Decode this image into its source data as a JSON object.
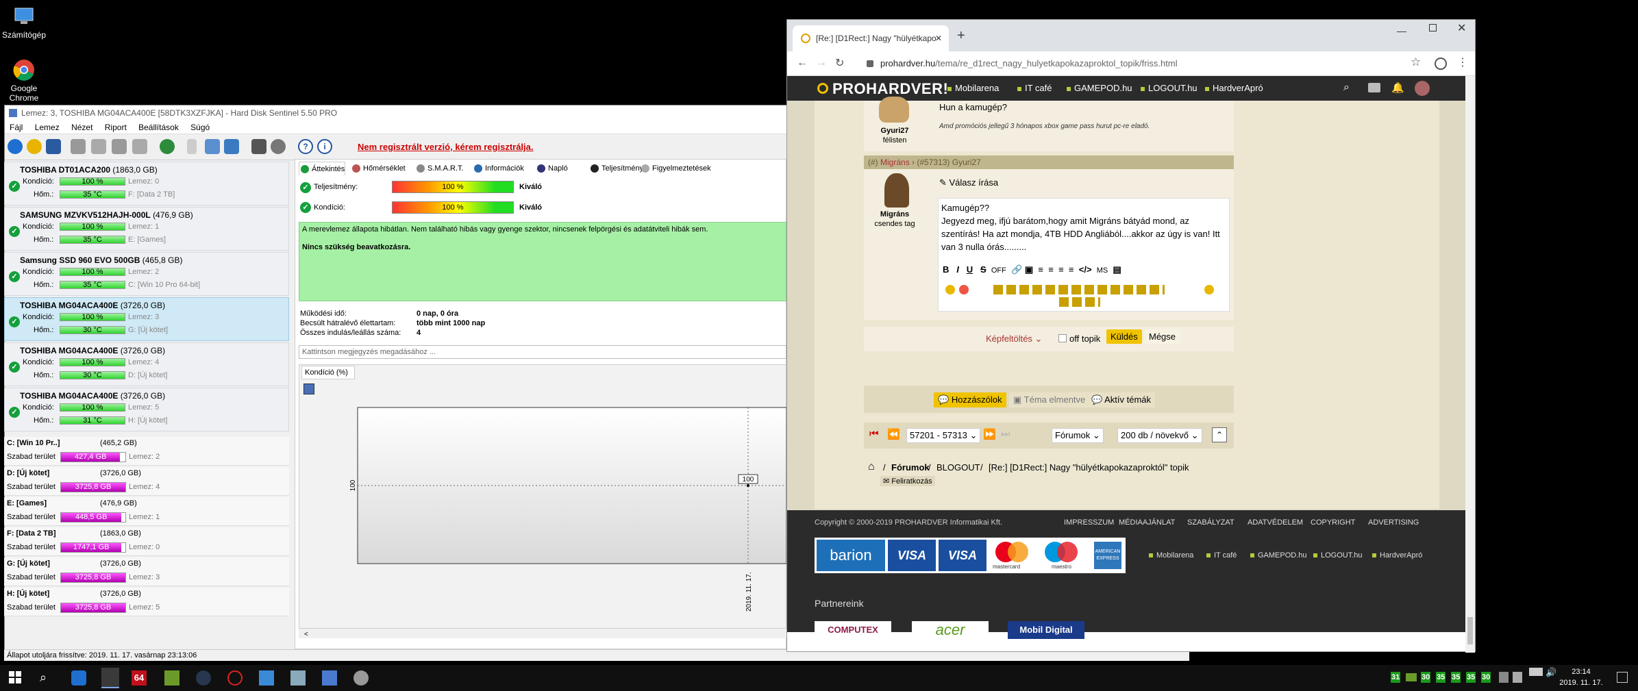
{
  "desktop": {
    "icons": [
      {
        "label": "Számítógép",
        "icon": "computer-icon"
      },
      {
        "label": "Google Chrome",
        "icon": "chrome-icon"
      }
    ]
  },
  "hds": {
    "title": "Lemez: 3, TOSHIBA MG04ACA400E [58DTK3XZFJKA] - Hard Disk Sentinel 5.50 PRO",
    "menu": [
      "Fájl",
      "Lemez",
      "Nézet",
      "Riport",
      "Beállítások",
      "Súgó"
    ],
    "register": "Nem regisztrált verzió, kérem regisztrálja.",
    "labels": {
      "cond": "Kondíció:",
      "temp": "Hőm.:",
      "free": "Szabad terület"
    },
    "disks": [
      {
        "name": "TOSHIBA DT01ACA200",
        "size": "(1863,0 GB)",
        "health": "100 %",
        "temp": "35 °C",
        "disk": "Lemez: 0",
        "vol": "F: [Data 2 TB]"
      },
      {
        "name": "SAMSUNG MZVKV512HAJH-000L",
        "size": "(476,9 GB)",
        "health": "100 %",
        "temp": "35 °C",
        "disk": "Lemez: 1",
        "vol": "E: [Games]"
      },
      {
        "name": "Samsung SSD 960 EVO 500GB",
        "size": "(465,8 GB)",
        "health": "100 %",
        "temp": "35 °C",
        "disk": "Lemez: 2",
        "vol": "C: [Win 10 Pro 64-bit]"
      },
      {
        "name": "TOSHIBA MG04ACA400E",
        "size": "(3726,0 GB)",
        "health": "100 %",
        "temp": "30 °C",
        "disk": "Lemez: 3",
        "vol": "G: [Új kötet]"
      },
      {
        "name": "TOSHIBA MG04ACA400E",
        "size": "(3726,0 GB)",
        "health": "100 %",
        "temp": "30 °C",
        "disk": "Lemez: 4",
        "vol": "D: [Új kötet]"
      },
      {
        "name": "TOSHIBA MG04ACA400E",
        "size": "(3726,0 GB)",
        "health": "100 %",
        "temp": "31 °C",
        "disk": "Lemez: 5",
        "vol": "H: [Új kötet]"
      }
    ],
    "partitions": [
      {
        "name": "C: [Win 10 Pr..]",
        "size": "(465,2 GB)",
        "free": "427,4 GB",
        "disk": "Lemez: 2",
        "fill": 0.92
      },
      {
        "name": "D: [Új kötet]",
        "size": "(3726,0 GB)",
        "free": "3725,8 GB",
        "disk": "Lemez: 4",
        "fill": 1.0
      },
      {
        "name": "E: [Games]",
        "size": "(476,9 GB)",
        "free": "448,5 GB",
        "disk": "Lemez: 1",
        "fill": 0.94
      },
      {
        "name": "F: [Data 2 TB]",
        "size": "(1863,0 GB)",
        "free": "1747,1 GB",
        "disk": "Lemez: 0",
        "fill": 0.94
      },
      {
        "name": "G: [Új kötet]",
        "size": "(3726,0 GB)",
        "free": "3725,8 GB",
        "disk": "Lemez: 3",
        "fill": 1.0
      },
      {
        "name": "H: [Új kötet]",
        "size": "(3726,0 GB)",
        "free": "3725,8 GB",
        "disk": "Lemez: 5",
        "fill": 1.0
      }
    ],
    "tabs": [
      "Áttekintés",
      "Hőmérséklet",
      "S.M.A.R.T.",
      "Információk",
      "Napló",
      "Teljesítmény",
      "Figyelmeztetések"
    ],
    "perf_label": "Teljesítmény:",
    "perf_value": "100 %",
    "perf_text": "Kiváló",
    "cond_label": "Kondíció:",
    "cond_value": "100 %",
    "cond_text": "Kiváló",
    "status_msg": "A merevlemez állapota hibátlan. Nem található hibás vagy gyenge szektor, nincsenek felpörgési és adatátviteli hibák sem.",
    "status_msg2": "Nincs szükség beavatkozásra.",
    "stats": [
      {
        "k": "Működési idő:",
        "v": "0 nap, 0 óra"
      },
      {
        "k": "Becsült hátralévő élettartam:",
        "v": "több mint 1000 nap"
      },
      {
        "k": "Összes indulás/leállás száma:",
        "v": "4"
      }
    ],
    "comment_placeholder": "Kattintson megjegyzés megadásához ...",
    "chart_tab": "Kondíció  (%)",
    "statusbar": "Állapot utoljára frissítve: 2019. 11. 17. vasárnap 23:13:06"
  },
  "chart_data": {
    "type": "line",
    "x": [
      "2019. 11. 17."
    ],
    "series": [
      {
        "values": [
          100
        ]
      }
    ],
    "ylabel": "100",
    "point_label": "100"
  },
  "chrome": {
    "tab_title": "[Re:] [D1Rect:] Nagy \"hülyétkapo",
    "url_host": "prohardver.hu",
    "url_path": "/tema/re_d1rect_nagy_hulyetkapokazaproktol_topik/friss.html",
    "brand": "PROHARDVER!",
    "nav": [
      "Mobilarena",
      "IT café",
      "GAMEPOD.hu",
      "LOGOUT.hu",
      "HardverApró"
    ],
    "post1": {
      "user": "Gyuri27",
      "rank": "félisten",
      "text": "Hun a kamugép?",
      "sig": "Amd promóciós jellegű 3 hónapos xbox game pass hurut pc-re eladó."
    },
    "reply_header": {
      "hash": "(#)",
      "user": "Migráns",
      "ref": "(#57313)",
      "to": "Gyuri27"
    },
    "reply": {
      "user": "Migráns",
      "rank": "csendes tag",
      "link": "Válasz írása",
      "text1": "Kamugép??",
      "text2": "Jegyezd meg, ifjú barátom,hogy amit Migráns bátyád mond, az szentírás! Ha azt mondja, 4TB HDD Angliából....akkor az úgy is van! Itt van 3 nulla órás........."
    },
    "editor_off": "OFF",
    "editor_ms": "MS",
    "upload": "Képfeltöltés",
    "offtopic": "off topik",
    "send": "Küldés",
    "cancel": "Mégse",
    "actions": [
      "Hozzászólok",
      "Téma elmentve",
      "Aktív témák"
    ],
    "pager": {
      "range": "57201 - 57313",
      "forums": "Fórumok",
      "perpage": "200 db / növekvő"
    },
    "breadcrumb": [
      "Fórumok",
      "BLOGOUT",
      "[Re:] [D1Rect:] Nagy \"hülyétkapokazaproktól\" topik"
    ],
    "subscribe": "Feliratkozás",
    "footer": {
      "copyright": "Copyright © 2000-2019 PROHARDVER Informatikai Kft.",
      "links": [
        "IMPRESSZUM",
        "MÉDIAAJÁNLAT",
        "SZABÁLYZAT",
        "ADATVÉDELEM",
        "COPYRIGHT",
        "ADVERTISING"
      ],
      "payments": [
        "barion",
        "VISA",
        "VISA",
        "mastercard",
        "maestro",
        "AMERICAN EXPRESS"
      ],
      "nav": [
        "Mobilarena",
        "IT café",
        "GAMEPOD.hu",
        "LOGOUT.hu",
        "HardverApró"
      ],
      "partners_title": "Partnereink",
      "partners": [
        "COMPUTEX",
        "acer",
        "Mobil Digital"
      ]
    }
  },
  "taskbar": {
    "time": "23:14",
    "date": "2019. 11. 17.",
    "tray_nums": [
      "31",
      "30",
      "35",
      "35",
      "35",
      "30"
    ]
  }
}
